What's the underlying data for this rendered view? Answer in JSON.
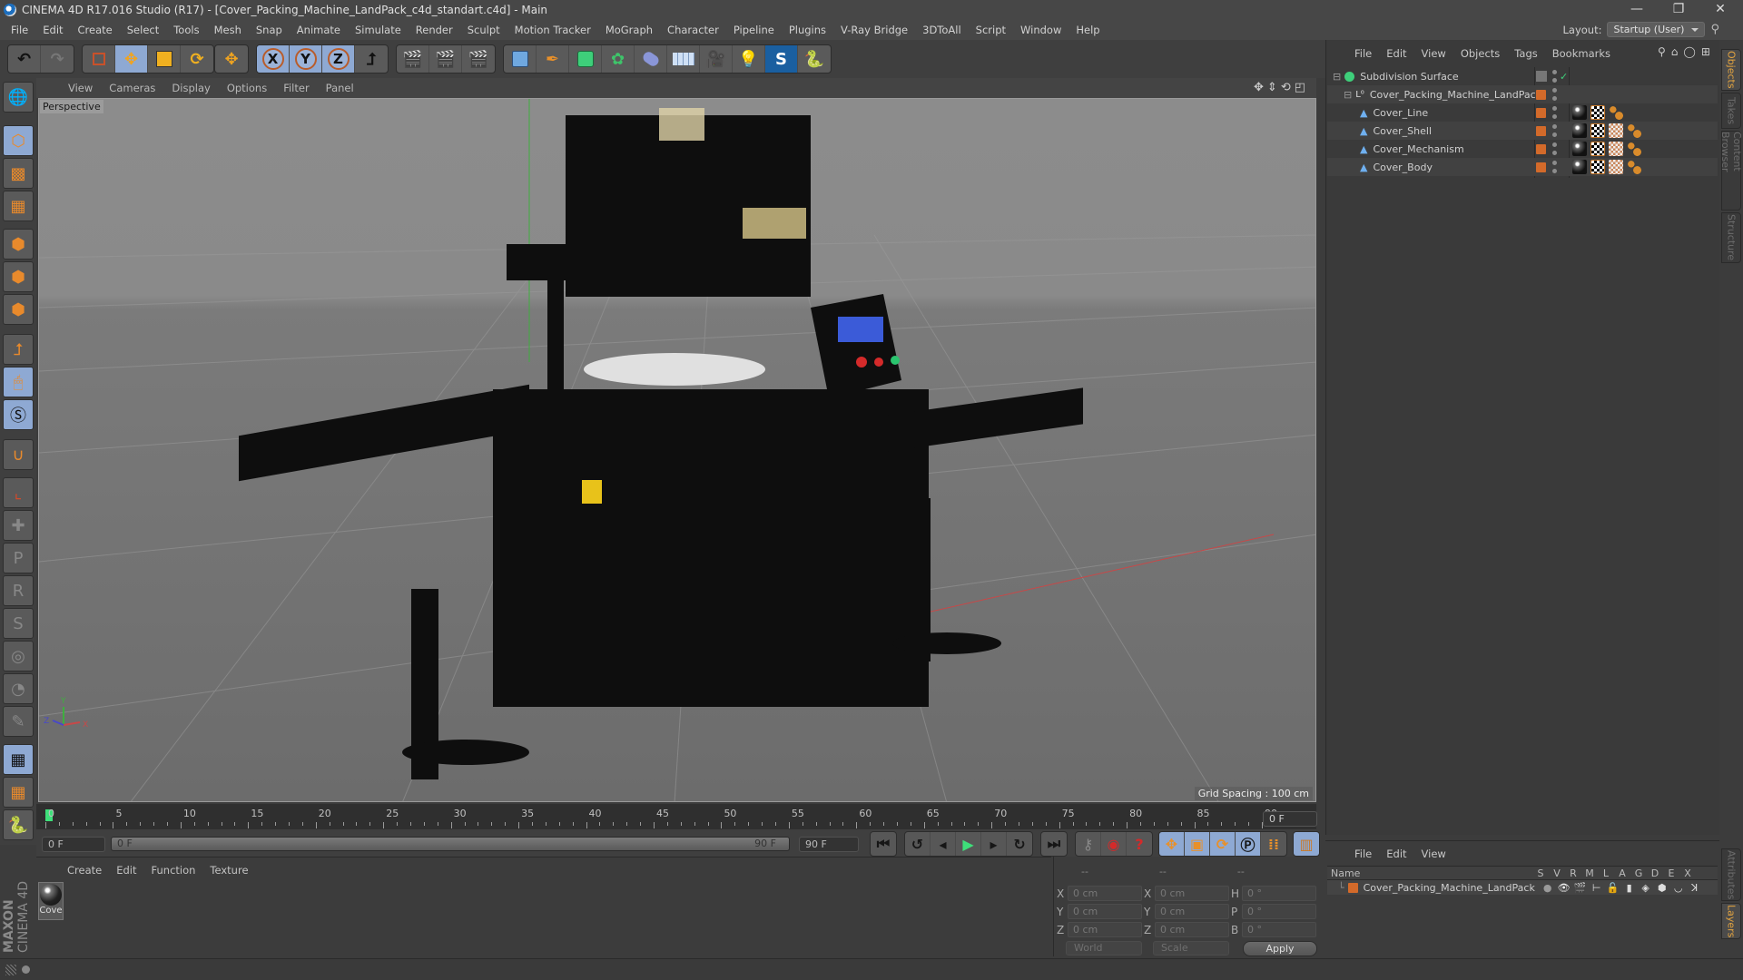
{
  "window": {
    "title": "CINEMA 4D R17.016 Studio (R17) - [Cover_Packing_Machine_LandPack_c4d_standart.c4d] - Main",
    "controls": {
      "minimize": "—",
      "restore": "❐",
      "close": "✕"
    }
  },
  "menubar": {
    "items": [
      "File",
      "Edit",
      "Create",
      "Select",
      "Tools",
      "Mesh",
      "Snap",
      "Animate",
      "Simulate",
      "Render",
      "Sculpt",
      "Motion Tracker",
      "MoGraph",
      "Character",
      "Pipeline",
      "Plugins",
      "V-Ray Bridge",
      "3DToAll",
      "Script",
      "Window",
      "Help"
    ],
    "layout_label": "Layout:",
    "layout_value": "Startup (User)"
  },
  "toolbar": {
    "groups": [
      [
        "undo-icon",
        "redo-icon"
      ],
      [
        "live-selection-icon",
        "move-icon",
        "scale-icon",
        "rotate-icon"
      ],
      [
        "last-tool-icon"
      ],
      [
        "x-axis-icon",
        "y-axis-icon",
        "z-axis-icon",
        "coordinate-system-icon"
      ],
      [
        "render-view-icon",
        "render-picture-viewer-icon",
        "render-settings-icon"
      ],
      [
        "cube-icon",
        "pen-spline-icon",
        "subdivision-icon",
        "cloner-icon",
        "deformer-icon",
        "floor-icon",
        "camera-icon",
        "light-icon",
        "v-ray-icon",
        "python-icon"
      ]
    ],
    "axis_labels": {
      "x": "X",
      "y": "Y",
      "z": "Z"
    }
  },
  "viewport": {
    "menu": [
      "View",
      "Cameras",
      "Display",
      "Options",
      "Filter",
      "Panel"
    ],
    "camera_label": "Perspective",
    "grid_spacing": "Grid Spacing : 100 cm",
    "axis": {
      "x": "X",
      "y": "Y",
      "z": "Z"
    }
  },
  "timeline": {
    "ticks": [
      0,
      5,
      10,
      15,
      20,
      25,
      30,
      35,
      40,
      45,
      50,
      55,
      60,
      65,
      70,
      75,
      80,
      85,
      90
    ],
    "current_frame": 0,
    "end_field": "0 F",
    "start_field": "0 F",
    "slider_start": "0 F",
    "slider_end": "90 F",
    "max_field": "90 F"
  },
  "material_manager": {
    "menu": [
      "Create",
      "Edit",
      "Function",
      "Texture"
    ],
    "materials": [
      {
        "name": "Cove"
      }
    ],
    "brand_top": "MAXON",
    "brand_bottom": "CINEMA 4D"
  },
  "coordinates": {
    "headers": [
      "--",
      "--",
      "--"
    ],
    "rows": [
      {
        "l1": "X",
        "v1": "0 cm",
        "l2": "X",
        "v2": "0 cm",
        "l3": "H",
        "v3": "0 °"
      },
      {
        "l1": "Y",
        "v1": "0 cm",
        "l2": "Y",
        "v2": "0 cm",
        "l3": "P",
        "v3": "0 °"
      },
      {
        "l1": "Z",
        "v1": "0 cm",
        "l2": "Z",
        "v2": "0 cm",
        "l3": "B",
        "v3": "0 °"
      }
    ],
    "space": "World",
    "mode": "Scale",
    "apply": "Apply"
  },
  "object_manager": {
    "menu": [
      "File",
      "Edit",
      "View",
      "Objects",
      "Tags",
      "Bookmarks"
    ],
    "objects": [
      {
        "name": "Subdivision Surface",
        "depth": 0,
        "type": "subdivision",
        "tags": []
      },
      {
        "name": "Cover_Packing_Machine_LandPack",
        "depth": 1,
        "type": "null",
        "tags": []
      },
      {
        "name": "Cover_Line",
        "depth": 2,
        "type": "polygon",
        "tags": [
          "material",
          "checker",
          "phong"
        ]
      },
      {
        "name": "Cover_Shell",
        "depth": 2,
        "type": "polygon",
        "tags": [
          "material",
          "checker",
          "uvw",
          "phong"
        ]
      },
      {
        "name": "Cover_Mechanism",
        "depth": 2,
        "type": "polygon",
        "tags": [
          "material",
          "checker",
          "uvw",
          "phong"
        ]
      },
      {
        "name": "Cover_Body",
        "depth": 2,
        "type": "polygon",
        "tags": [
          "material",
          "checker",
          "uvw",
          "phong"
        ]
      }
    ]
  },
  "side_tabs_top": [
    {
      "label": "Objects",
      "active": true
    },
    {
      "label": "Takes",
      "active": false
    },
    {
      "label": "Content Browser",
      "active": false
    },
    {
      "label": "Structure",
      "active": false
    }
  ],
  "side_tabs_bottom": [
    {
      "label": "Attributes",
      "active": false
    },
    {
      "label": "Layers",
      "active": true
    }
  ],
  "layer_manager": {
    "menu": [
      "File",
      "Edit",
      "View"
    ],
    "columns": [
      "Name",
      "S",
      "V",
      "R",
      "M",
      "L",
      "A",
      "G",
      "D",
      "E",
      "X"
    ],
    "layers": [
      {
        "name": "Cover_Packing_Machine_LandPack",
        "color": "#d36a2a"
      }
    ]
  },
  "colors": {
    "accent_orange": "#d36a2a",
    "active_blue": "#8ea9d3",
    "play_green": "#3ee07a"
  }
}
